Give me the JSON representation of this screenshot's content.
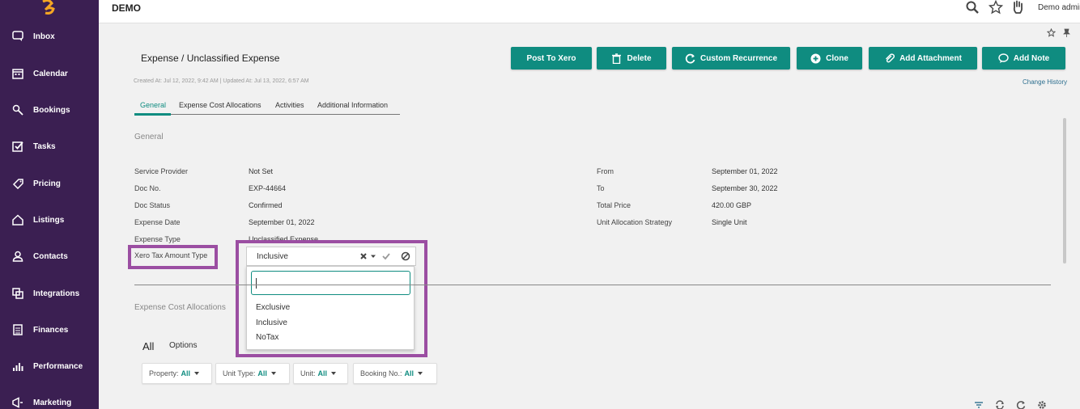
{
  "app": {
    "title": "DEMO",
    "user": "Demo admin"
  },
  "colors": {
    "sidebar": "#3b1f52",
    "accent": "#0f8c80",
    "highlight": "#9b4ea2"
  },
  "sidebar": {
    "items": [
      {
        "label": "Inbox",
        "icon": "chat-icon"
      },
      {
        "label": "Calendar",
        "icon": "calendar-icon"
      },
      {
        "label": "Bookings",
        "icon": "key-icon"
      },
      {
        "label": "Tasks",
        "icon": "checkbox-icon"
      },
      {
        "label": "Pricing",
        "icon": "tag-icon"
      },
      {
        "label": "Listings",
        "icon": "home-icon"
      },
      {
        "label": "Contacts",
        "icon": "user-icon"
      },
      {
        "label": "Integrations",
        "icon": "integrations-icon"
      },
      {
        "label": "Finances",
        "icon": "ledger-icon"
      },
      {
        "label": "Performance",
        "icon": "bar-chart-icon"
      },
      {
        "label": "Marketing",
        "icon": "megaphone-icon"
      }
    ]
  },
  "page": {
    "breadcrumb": "Expense / Unclassified Expense",
    "meta": "Created At: Jul 12, 2022, 9:42 AM  |  Updated At: Jul 13, 2022, 6:57 AM",
    "change_history": "Change History",
    "buttons": {
      "post_to_xero": "Post To Xero",
      "delete": "Delete",
      "custom_recurrence": "Custom Recurrence",
      "clone": "Clone",
      "add_attachment": "Add Attachment",
      "add_note": "Add Note"
    },
    "tabs": [
      "General",
      "Expense Cost Allocations",
      "Activities",
      "Additional Information"
    ],
    "section_title": "General",
    "fields_left": [
      {
        "label": "Service Provider",
        "value": "Not Set"
      },
      {
        "label": "Doc No.",
        "value": "EXP-44664"
      },
      {
        "label": "Doc Status",
        "value": "Confirmed"
      },
      {
        "label": "Expense Date",
        "value": "September 01, 2022"
      },
      {
        "label": "Expense Type",
        "value": "Unclassified Expense"
      }
    ],
    "fields_right": [
      {
        "label": "From",
        "value": "September 01, 2022"
      },
      {
        "label": "To",
        "value": "September 30, 2022"
      },
      {
        "label": "Total Price",
        "value": "420.00 GBP"
      },
      {
        "label": "Unit Allocation Strategy",
        "value": "Single Unit"
      }
    ],
    "xero_tax": {
      "label": "Xero Tax Amount Type",
      "selected": "Inclusive",
      "search_value": "",
      "options": [
        "Exclusive",
        "Inclusive",
        "NoTax"
      ]
    },
    "section2_title": "Expense Cost Allocations",
    "list": {
      "all_label": "All",
      "options_label": "Options",
      "filters": [
        {
          "label": "Property:",
          "value": "All"
        },
        {
          "label": "Unit Type:",
          "value": "All"
        },
        {
          "label": "Unit:",
          "value": "All"
        },
        {
          "label": "Booking No.:",
          "value": "All"
        }
      ]
    }
  }
}
